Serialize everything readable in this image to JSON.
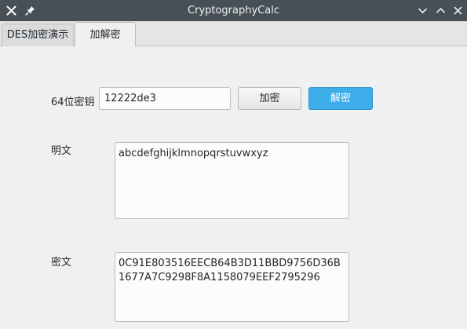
{
  "window": {
    "title": "CryptographyCalc"
  },
  "tabs": [
    {
      "label": "DES加密演示"
    },
    {
      "label": "加解密"
    }
  ],
  "form": {
    "key_label": "64位密钥",
    "key_value": "12222de3",
    "encrypt_label": "加密",
    "decrypt_label": "解密",
    "plaintext_label": "明文",
    "plaintext_value": "abcdefghijklmnopqrstuvwxyz",
    "ciphertext_label": "密文",
    "ciphertext_value": "0C91E803516EECB64B3D11BBD9756D36B1677A7C9298F8A1158079EEF2795296"
  },
  "colors": {
    "titlebar": "#475057",
    "accent": "#3daee9",
    "background": "#eff0f1"
  },
  "icons": {
    "close": "close-icon",
    "pin": "pin-icon",
    "minimize": "chevron-down-icon",
    "maximize": "chevron-up-icon",
    "window_close": "close-icon"
  }
}
